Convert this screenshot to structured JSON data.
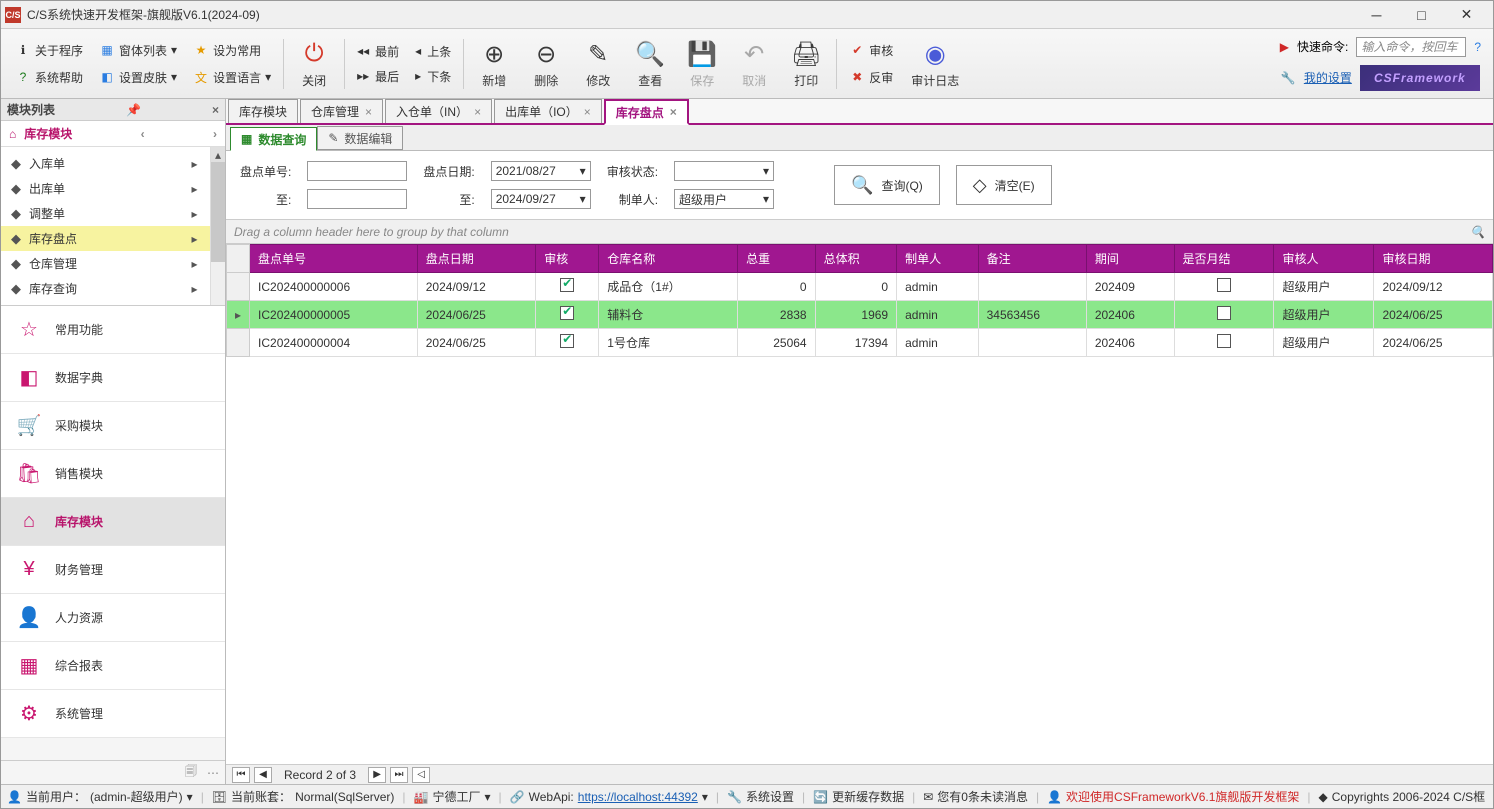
{
  "window": {
    "title": "C/S系统快速开发框架-旗舰版V6.1(2024-09)",
    "icon_text": "C/S"
  },
  "ribbon": {
    "left_groups": [
      {
        "items": [
          {
            "icon": "info-icon",
            "label": "关于程序",
            "dd": false
          },
          {
            "icon": "help-icon",
            "label": "系统帮助",
            "dd": false
          }
        ]
      },
      {
        "items": [
          {
            "icon": "forms-icon",
            "label": "窗体列表",
            "dd": true
          },
          {
            "icon": "skin-icon",
            "label": "设置皮肤",
            "dd": true
          }
        ]
      },
      {
        "items": [
          {
            "icon": "star-icon",
            "label": "设为常用",
            "dd": false
          },
          {
            "icon": "lang-icon",
            "label": "设置语言",
            "dd": true
          }
        ]
      }
    ],
    "big_close": {
      "label": "关闭",
      "color": "#d43a2b"
    },
    "nav_pairs": [
      [
        {
          "label": "最前",
          "sym": "⏮"
        },
        {
          "label": "最后",
          "sym": "⏭"
        }
      ],
      [
        {
          "label": "上条",
          "sym": "◀"
        },
        {
          "label": "下条",
          "sym": "▶"
        }
      ]
    ],
    "big_buttons": [
      {
        "name": "add",
        "label": "新增",
        "color": "#3a3a3a"
      },
      {
        "name": "delete",
        "label": "删除",
        "color": "#3a3a3a"
      },
      {
        "name": "edit",
        "label": "修改",
        "color": "#3a3a3a"
      },
      {
        "name": "view",
        "label": "查看",
        "color": "#3a3a3a"
      },
      {
        "name": "save",
        "label": "保存",
        "color": "#a8a8a8"
      },
      {
        "name": "cancel",
        "label": "取消",
        "color": "#a8a8a8"
      },
      {
        "name": "print",
        "label": "打印",
        "color": "#3a3a3a"
      }
    ],
    "audit_pair": [
      {
        "label": "审核",
        "icon": "✔",
        "color": "#d43a2b"
      },
      {
        "label": "反审",
        "icon": "✖",
        "color": "#d43a2b"
      }
    ],
    "audit_log": {
      "label": "审计日志"
    },
    "quick_cmd": {
      "label": "快速命令:",
      "placeholder": "输入命令，按回车"
    },
    "my_settings": "我的设置",
    "badge": "CSFramework"
  },
  "sidebar": {
    "title": "模块列表",
    "category": "库存模块",
    "tree": [
      {
        "label": "入库单",
        "active": false
      },
      {
        "label": "出库单",
        "active": false
      },
      {
        "label": "调整单",
        "active": false
      },
      {
        "label": "库存盘点",
        "active": true
      },
      {
        "label": "仓库管理",
        "active": false
      },
      {
        "label": "库存查询",
        "active": false
      }
    ],
    "big": [
      {
        "icon": "☆",
        "label": "常用功能"
      },
      {
        "icon": "◧",
        "label": "数据字典"
      },
      {
        "icon": "🛒",
        "label": "采购模块"
      },
      {
        "icon": "🛍",
        "label": "销售模块"
      },
      {
        "icon": "⌂",
        "label": "库存模块",
        "active": true
      },
      {
        "icon": "¥",
        "label": "财务管理"
      },
      {
        "icon": "👤",
        "label": "人力资源"
      },
      {
        "icon": "▦",
        "label": "综合报表"
      },
      {
        "icon": "⚙",
        "label": "系统管理"
      }
    ]
  },
  "tabs": [
    {
      "label": "库存模块",
      "closable": false
    },
    {
      "label": "仓库管理",
      "closable": true
    },
    {
      "label": "入仓单（IN）",
      "closable": true
    },
    {
      "label": "出库单（IO）",
      "closable": true
    },
    {
      "label": "库存盘点",
      "closable": true,
      "active": true
    }
  ],
  "subtabs": [
    {
      "icon": "▦",
      "label": "数据查询",
      "active": true
    },
    {
      "icon": "✎",
      "label": "数据编辑"
    }
  ],
  "filters": {
    "f1": {
      "label": "盘点单号:",
      "value": ""
    },
    "f2": {
      "label": "至:",
      "value": ""
    },
    "d1": {
      "label": "盘点日期:",
      "value": "2021/08/27"
    },
    "d2": {
      "label": "至:",
      "value": "2024/09/27"
    },
    "s1": {
      "label": "审核状态:",
      "value": ""
    },
    "s2": {
      "label": "制单人:",
      "value": "超级用户"
    },
    "btn_query": "查询(Q)",
    "btn_clear": "清空(E)"
  },
  "group_hint": "Drag a column header here to group by that column",
  "columns": [
    "盘点单号",
    "盘点日期",
    "审核",
    "仓库名称",
    "总重",
    "总体积",
    "制单人",
    "备注",
    "期间",
    "是否月结",
    "审核人",
    "审核日期"
  ],
  "rows": [
    {
      "sel": false,
      "c": [
        "IC202400000006",
        "2024/09/12",
        true,
        "成品仓（1#）",
        "0",
        "0",
        "admin",
        "",
        "202409",
        false,
        "超级用户",
        "2024/09/12"
      ]
    },
    {
      "sel": true,
      "c": [
        "IC202400000005",
        "2024/06/25",
        true,
        "辅料仓",
        "2838",
        "1969",
        "admin",
        "34563456",
        "202406",
        false,
        "超级用户",
        "2024/06/25"
      ]
    },
    {
      "sel": false,
      "c": [
        "IC202400000004",
        "2024/06/25",
        true,
        "1号仓库",
        "25064",
        "17394",
        "admin",
        "",
        "202406",
        false,
        "超级用户",
        "2024/06/25"
      ]
    }
  ],
  "pager": {
    "text": "Record 2 of 3"
  },
  "status": {
    "user_label": "当前用户：",
    "user": "(admin-超级用户)",
    "acct_label": "当前账套：",
    "acct": "Normal(SqlServer)",
    "factory": "宁德工厂",
    "webapi_label": "WebApi:",
    "webapi": "https://localhost:44392",
    "sys": "系统设置",
    "refresh": "更新缓存数据",
    "msg": "您有0条未读消息",
    "welcome": "欢迎使用CSFrameworkV6.1旗舰版开发框架",
    "copy": "Copyrights 2006-2024 C/S框"
  }
}
